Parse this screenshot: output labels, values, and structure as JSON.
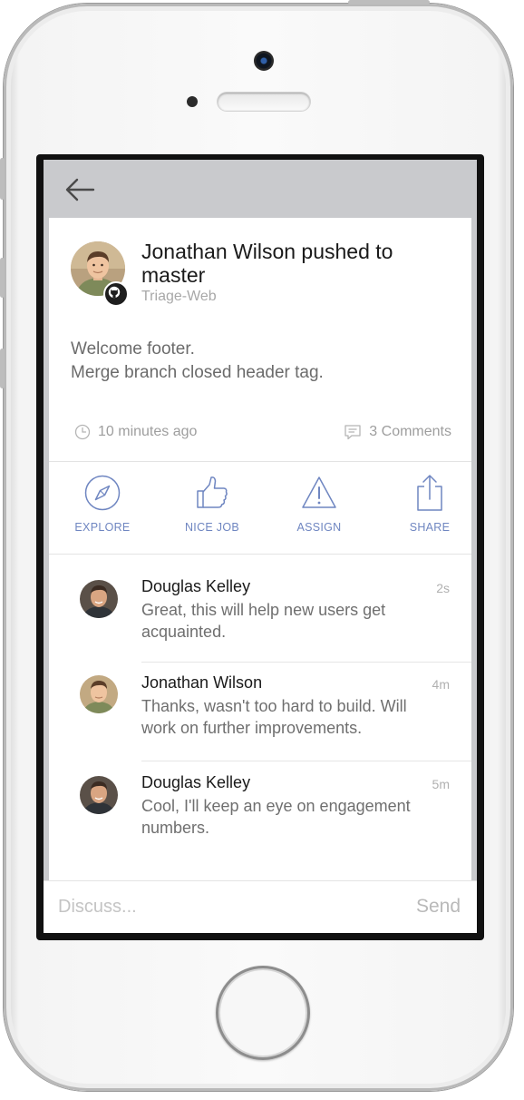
{
  "header": {
    "back_icon": "back-arrow-icon"
  },
  "post": {
    "title": "Jonathan Wilson pushed to master",
    "repo": "Triage-Web",
    "body_lines": [
      "Welcome footer.",
      "Merge branch closed header tag."
    ],
    "time": "10 minutes ago",
    "comments_count": "3 Comments",
    "badge_icon": "github-icon"
  },
  "actions": [
    {
      "label": "EXPLORE",
      "icon": "compass-icon"
    },
    {
      "label": "NICE JOB",
      "icon": "thumbs-up-icon"
    },
    {
      "label": "ASSIGN",
      "icon": "warning-icon"
    },
    {
      "label": "SHARE",
      "icon": "share-icon"
    }
  ],
  "comments": [
    {
      "author": "Douglas Kelley",
      "time": "2s",
      "text": "Great, this will help new users get acquainted."
    },
    {
      "author": "Jonathan Wilson",
      "time": "4m",
      "text": "Thanks, wasn't too hard to build. Will work on further improvements."
    },
    {
      "author": "Douglas Kelley",
      "time": "5m",
      "text": "Cool, I'll keep an eye on engagement numbers."
    }
  ],
  "composer": {
    "placeholder": "Discuss...",
    "send_label": "Send"
  },
  "colors": {
    "accent": "#6f86c1",
    "top_bar": "#c9cacd",
    "muted_text": "#9e9e9e"
  }
}
